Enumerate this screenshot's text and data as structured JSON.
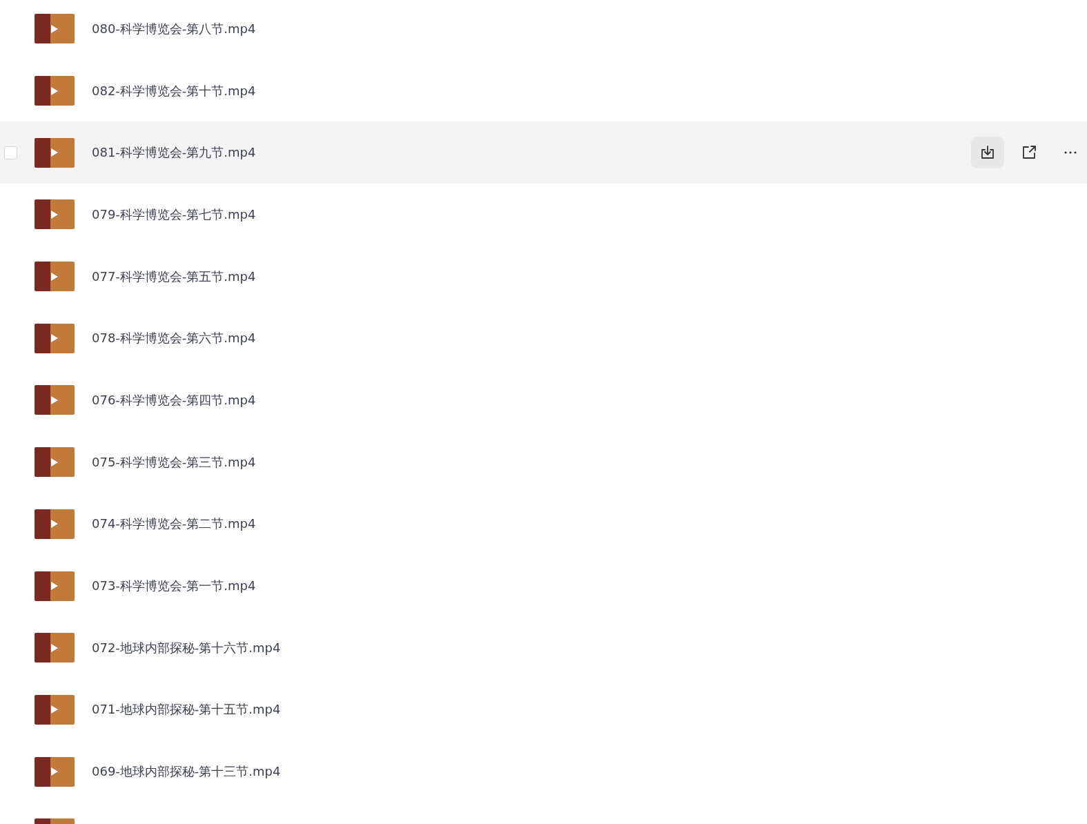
{
  "files": [
    {
      "name": "080-科学博览会-第八节.mp4",
      "highlighted": false
    },
    {
      "name": "082-科学博览会-第十节.mp4",
      "highlighted": false
    },
    {
      "name": "081-科学博览会-第九节.mp4",
      "highlighted": true,
      "checked": false
    },
    {
      "name": "079-科学博览会-第七节.mp4",
      "highlighted": false
    },
    {
      "name": "077-科学博览会-第五节.mp4",
      "highlighted": false
    },
    {
      "name": "078-科学博览会-第六节.mp4",
      "highlighted": false
    },
    {
      "name": "076-科学博览会-第四节.mp4",
      "highlighted": false
    },
    {
      "name": "075-科学博览会-第三节.mp4",
      "highlighted": false
    },
    {
      "name": "074-科学博览会-第二节.mp4",
      "highlighted": false
    },
    {
      "name": "073-科学博览会-第一节.mp4",
      "highlighted": false
    },
    {
      "name": "072-地球内部探秘-第十六节.mp4",
      "highlighted": false
    },
    {
      "name": "071-地球内部探秘-第十五节.mp4",
      "highlighted": false
    },
    {
      "name": "069-地球内部探秘-第十三节.mp4",
      "highlighted": false
    },
    {
      "highlighted": false
    }
  ]
}
